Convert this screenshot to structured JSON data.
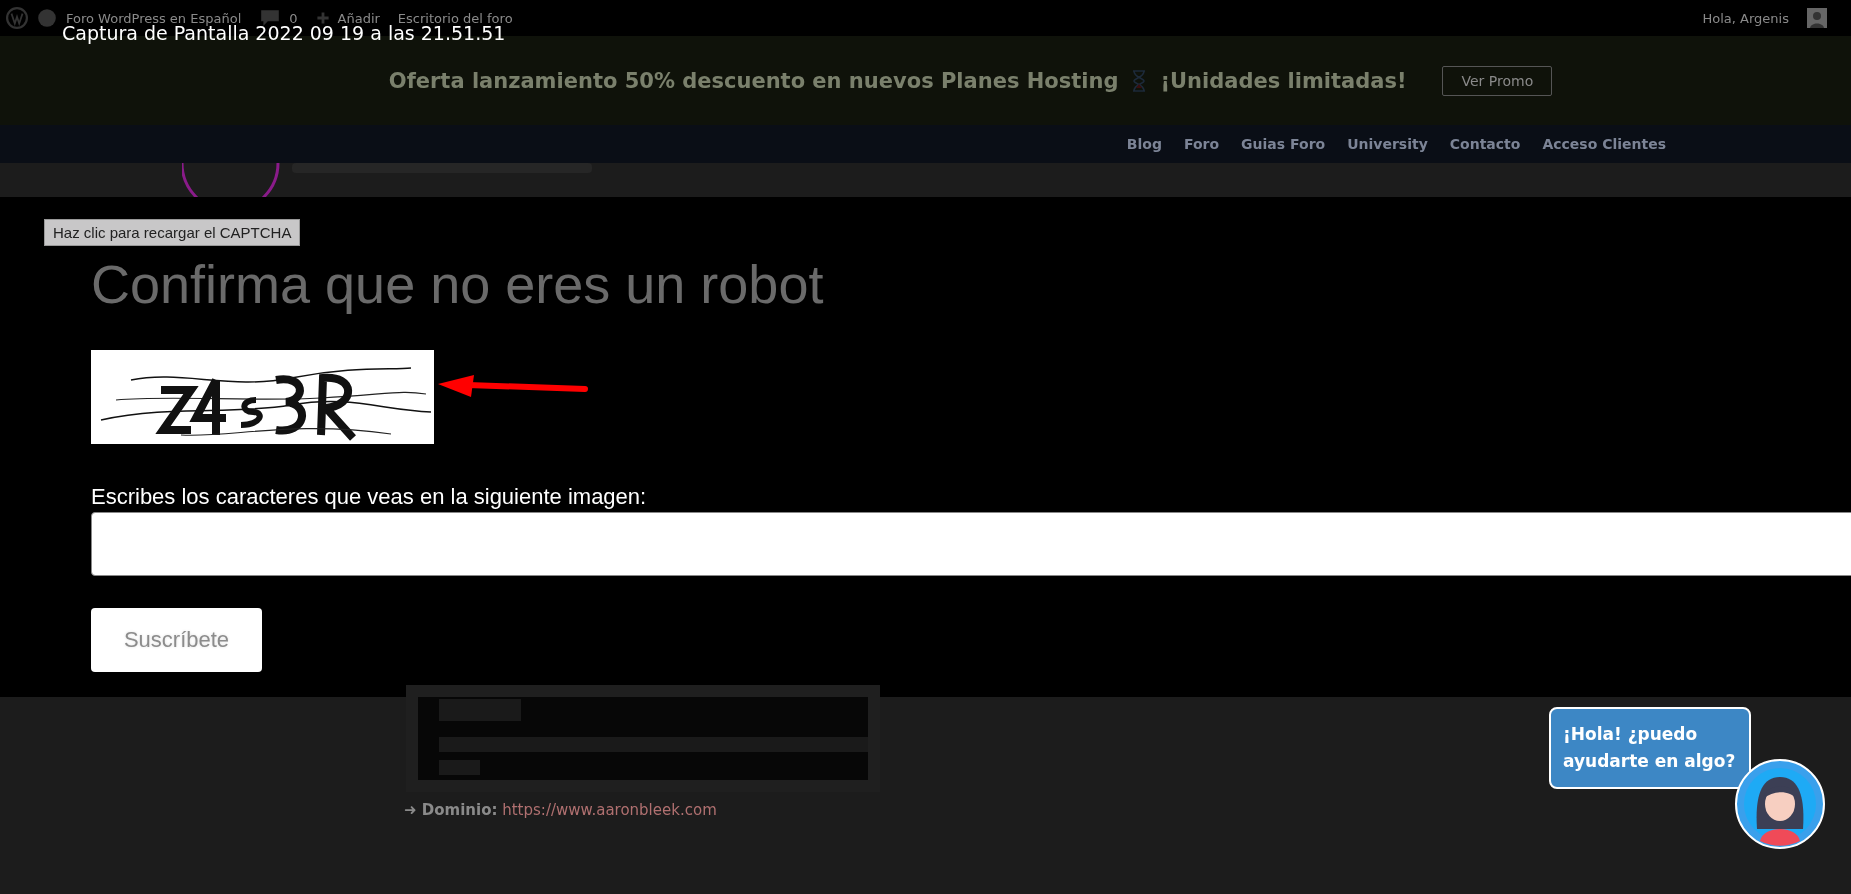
{
  "screenshot_title": "Captura de Pantalla 2022 09 19 a las 21.51.51",
  "admin_bar": {
    "site": "Foro WordPress en Español",
    "comments": "0",
    "add": "Añadir",
    "dashboard": "Escritorio del foro",
    "greeting": "Hola, Argenis"
  },
  "promo": {
    "text": "Oferta lanzamiento 50% descuento en nuevos Planes Hosting",
    "tagline": "¡Unidades limitadas!",
    "button": "Ver Promo"
  },
  "nav": [
    "Blog",
    "Foro",
    "Guias Foro",
    "University",
    "Contacto",
    "Acceso Clientes"
  ],
  "captcha_modal": {
    "tooltip": "Haz clic para recargar el CAPTCHA",
    "heading": "Confirma que no eres un robot",
    "label": "Escribes los caracteres que veas en la siguiente imagen:",
    "button": "Suscríbete"
  },
  "page": {
    "domain_label": "➜ Dominio:",
    "domain_url": "https://www.aaronbleek.com"
  },
  "chat": {
    "message": "¡Hola! ¿puedo ayudarte en algo?"
  }
}
